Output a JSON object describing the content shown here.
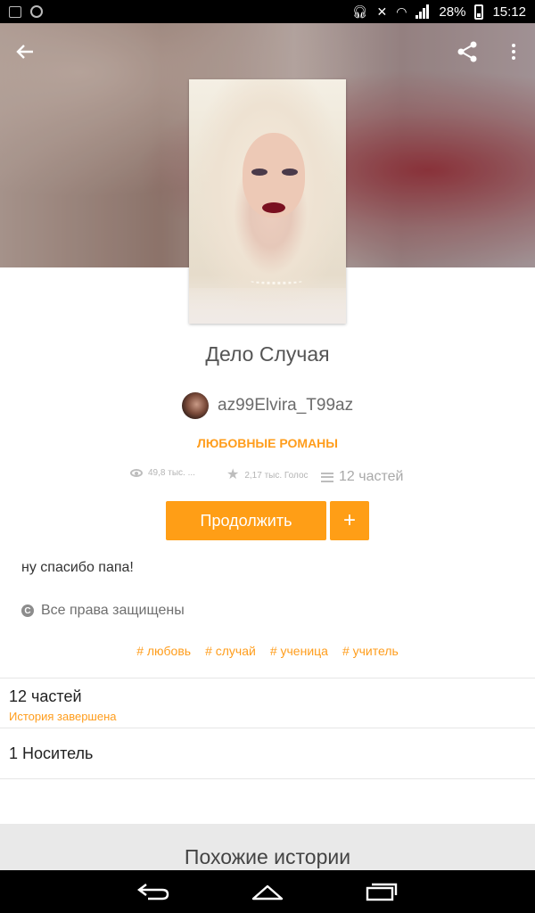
{
  "status_bar": {
    "battery": "28%",
    "time": "15:12"
  },
  "toolbar": {
    "back_icon": "arrow-left-icon",
    "share_icon": "share-icon",
    "more_icon": "more-vert-icon"
  },
  "story": {
    "title": "Дело Случая",
    "author": "az99Elvira_T99az",
    "genre": "ЛЮБОВНЫЕ РОМАНЫ",
    "stats": {
      "views": "49,8 тыс. ...",
      "votes": "2,17 тыс. Голос",
      "parts": "12 частей"
    },
    "continue_label": "Продолжить",
    "add_label": "+",
    "description": "ну спасибо папа!",
    "copyright": "Все права защищены",
    "tags": [
      "# любовь",
      "# случай",
      "# ученица",
      "# учитель"
    ]
  },
  "parts_section": {
    "title": "12 частей",
    "status": "История завершена"
  },
  "carrier_section": {
    "title": "1 Носитель"
  },
  "similar": {
    "title": "Похожие истории"
  },
  "colors": {
    "accent": "#ff9e16",
    "status_bar": "#000000"
  }
}
